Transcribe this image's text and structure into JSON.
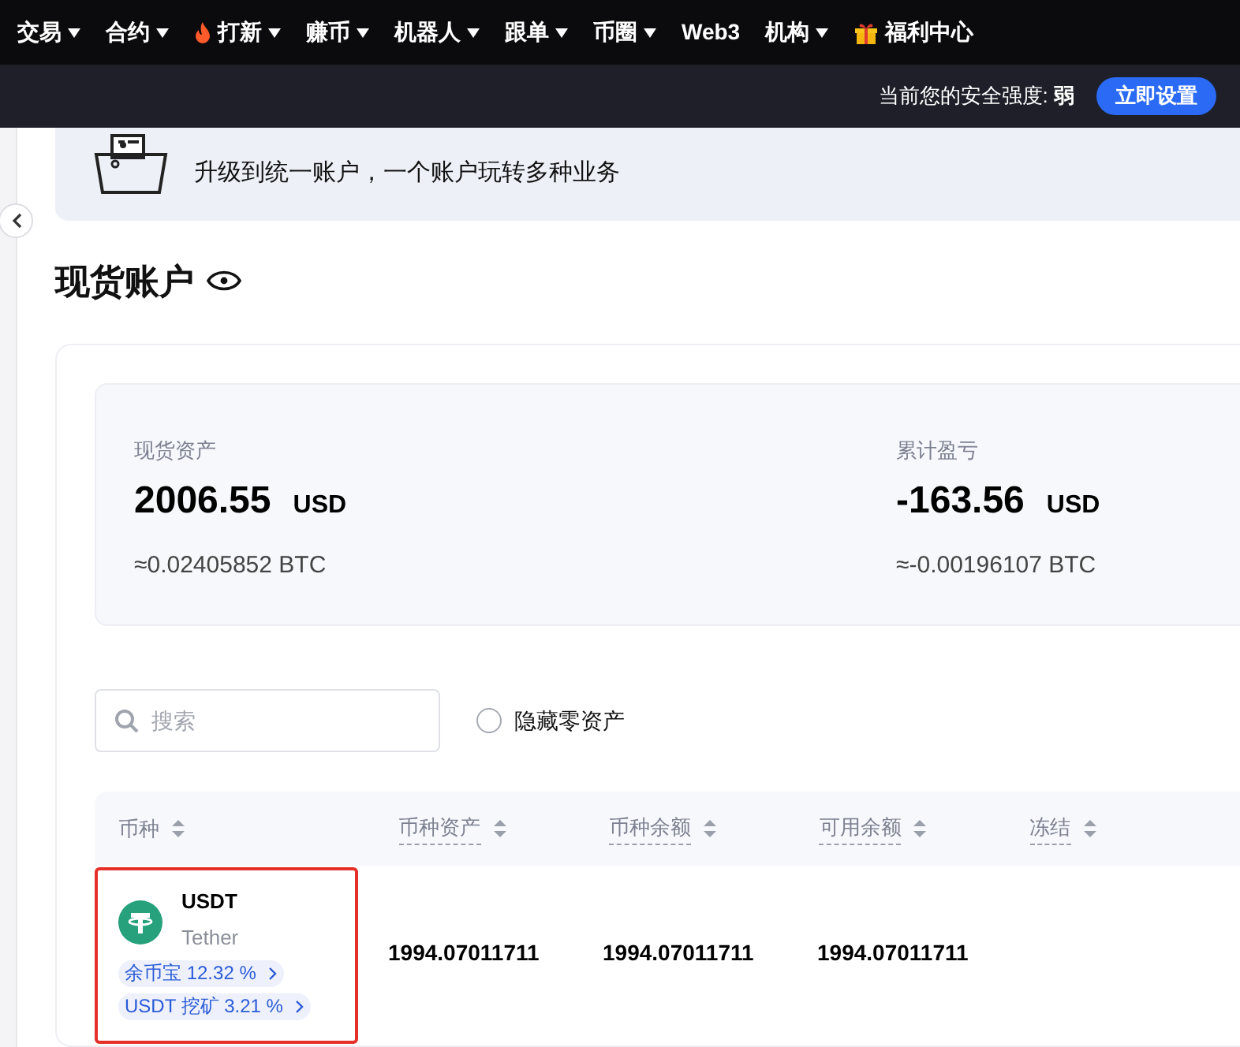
{
  "nav": [
    {
      "label": "交易",
      "kind": "text",
      "dropdown": true
    },
    {
      "label": "合约",
      "kind": "text",
      "dropdown": true
    },
    {
      "label": "打新",
      "kind": "fire",
      "dropdown": true
    },
    {
      "label": "赚币",
      "kind": "text",
      "dropdown": true
    },
    {
      "label": "机器人",
      "kind": "text",
      "dropdown": true
    },
    {
      "label": "跟单",
      "kind": "text",
      "dropdown": true
    },
    {
      "label": "币圈",
      "kind": "text",
      "dropdown": true
    },
    {
      "label": "Web3",
      "kind": "text",
      "dropdown": false
    },
    {
      "label": "机构",
      "kind": "text",
      "dropdown": true
    },
    {
      "label": "福利中心",
      "kind": "gift",
      "dropdown": false
    }
  ],
  "security_bar": {
    "label": "当前您的安全强度:",
    "level": "弱",
    "button": "立即设置"
  },
  "banner": {
    "text": "升级到统一账户，一个账户玩转多种业务"
  },
  "title": "现货账户",
  "summary": [
    {
      "label": "现货资产",
      "value": "2006.55",
      "unit": "USD",
      "btc": "≈0.02405852 BTC"
    },
    {
      "label": "累计盈亏",
      "value": "-163.56",
      "unit": "USD",
      "btc": "≈-0.00196107 BTC"
    }
  ],
  "search": {
    "placeholder": "搜索"
  },
  "hide_zero": {
    "label": "隐藏零资产",
    "checked": false
  },
  "table": {
    "columns": [
      {
        "label": "币种",
        "hint": false
      },
      {
        "label": "币种资产",
        "hint": true
      },
      {
        "label": "币种余额",
        "hint": true
      },
      {
        "label": "可用余额",
        "hint": true
      },
      {
        "label": "冻结",
        "hint": true
      }
    ],
    "rows": [
      {
        "highlighted": true,
        "cells": [
          {
            "kind": "coin",
            "symbol": "USDT",
            "name": "Tether",
            "tags": [
              "余币宝 12.32 %",
              "USDT 挖矿 3.21 %"
            ]
          },
          {
            "kind": "number",
            "text": "1994.07011711"
          },
          {
            "kind": "number",
            "text": "1994.07011711"
          },
          {
            "kind": "number",
            "text": "1994.07011711"
          }
        ]
      }
    ]
  }
}
